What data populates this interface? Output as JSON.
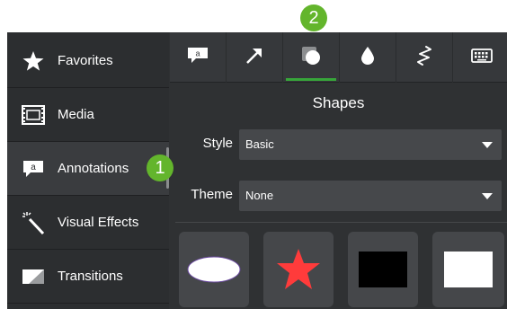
{
  "callouts": {
    "step1": "1",
    "step2": "2"
  },
  "sidebar": {
    "items": [
      {
        "label": "Favorites",
        "icon": "star-icon"
      },
      {
        "label": "Media",
        "icon": "film-strip-icon"
      },
      {
        "label": "Annotations",
        "icon": "speech-bubble-icon",
        "active": true
      },
      {
        "label": "Visual Effects",
        "icon": "magic-wand-icon"
      },
      {
        "label": "Transitions",
        "icon": "transition-icon"
      }
    ]
  },
  "tabs": [
    {
      "icon": "callout-icon"
    },
    {
      "icon": "arrow-icon"
    },
    {
      "icon": "shape-icon",
      "active": true
    },
    {
      "icon": "blur-drop-icon"
    },
    {
      "icon": "sketch-motion-icon"
    },
    {
      "icon": "keyboard-icon"
    }
  ],
  "panel": {
    "title": "Shapes",
    "style": {
      "label": "Style",
      "value": "Basic"
    },
    "theme": {
      "label": "Theme",
      "value": "None"
    }
  },
  "shapes": [
    {
      "name": "ellipse",
      "color": "#ffffff"
    },
    {
      "name": "star",
      "color": "#ff3b3b"
    },
    {
      "name": "black-rectangle",
      "color": "#000000"
    },
    {
      "name": "white-rectangle",
      "color": "#ffffff"
    }
  ],
  "colors": {
    "accent": "#37a63a",
    "badge": "#63b52c"
  }
}
